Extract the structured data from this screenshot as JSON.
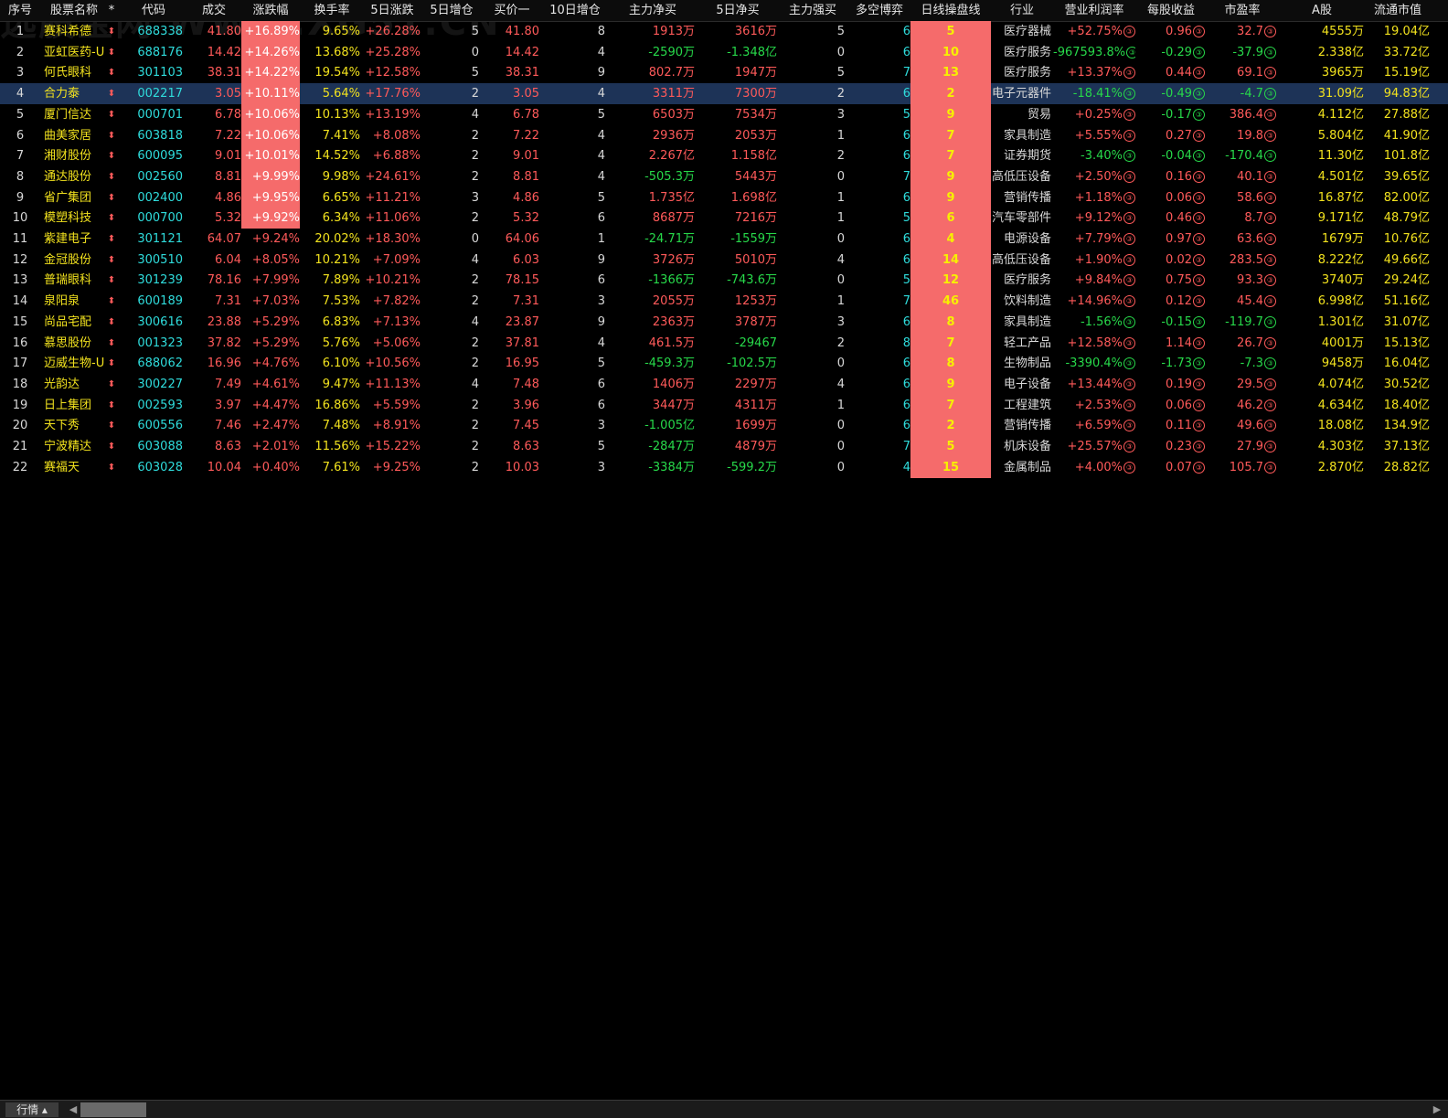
{
  "watermark": "选股宝网 WWW.XG51.CN",
  "header": [
    "序号",
    "股票名称",
    "*",
    "代码",
    "成交",
    "涨跌幅",
    "换手率",
    "5日涨跌",
    "5日增仓",
    "买价一",
    "10日增仓",
    "主力净买",
    "5日净买",
    "主力强买",
    "多空博弈",
    "日线操盘线",
    "行业",
    "营业利润率",
    "每股收益",
    "市盈率",
    "A股",
    "流通市值"
  ],
  "selected_row": 3,
  "rows": [
    [
      "1",
      "赛科希德",
      "⬍",
      "688338",
      "41.80",
      "+16.89%",
      "9.65%",
      "+26.28%",
      "5",
      "41.80",
      "8",
      "1913万",
      "3616万",
      "5",
      "6",
      "5",
      "医疗器械",
      "+52.75%",
      "0.96",
      "32.7",
      "4555万",
      "19.04亿"
    ],
    [
      "2",
      "亚虹医药-U",
      "⬍",
      "688176",
      "14.42",
      "+14.26%",
      "13.68%",
      "+25.28%",
      "0",
      "14.42",
      "4",
      "-2590万",
      "-1.348亿",
      "0",
      "6",
      "10",
      "医疗服务",
      "-967593.8%",
      "-0.29",
      "-37.9",
      "2.338亿",
      "33.72亿"
    ],
    [
      "3",
      "何氏眼科",
      "⬍",
      "301103",
      "38.31",
      "+14.22%",
      "19.54%",
      "+12.58%",
      "5",
      "38.31",
      "9",
      "802.7万",
      "1947万",
      "5",
      "7",
      "13",
      "医疗服务",
      "+13.37%",
      "0.44",
      "69.1",
      "3965万",
      "15.19亿"
    ],
    [
      "4",
      "合力泰",
      "⬍",
      "002217",
      "3.05",
      "+10.11%",
      "5.64%",
      "+17.76%",
      "2",
      "3.05",
      "4",
      "3311万",
      "7300万",
      "2",
      "6",
      "2",
      "电子元器件",
      "-18.41%",
      "-0.49",
      "-4.7",
      "31.09亿",
      "94.83亿"
    ],
    [
      "5",
      "厦门信达",
      "⬍",
      "000701",
      "6.78",
      "+10.06%",
      "10.13%",
      "+13.19%",
      "4",
      "6.78",
      "5",
      "6503万",
      "7534万",
      "3",
      "5",
      "9",
      "贸易",
      "+0.25%",
      "-0.17",
      "386.4",
      "4.112亿",
      "27.88亿"
    ],
    [
      "6",
      "曲美家居",
      "⬍",
      "603818",
      "7.22",
      "+10.06%",
      "7.41%",
      "+8.08%",
      "2",
      "7.22",
      "4",
      "2936万",
      "2053万",
      "1",
      "6",
      "7",
      "家具制造",
      "+5.55%",
      "0.27",
      "19.8",
      "5.804亿",
      "41.90亿"
    ],
    [
      "7",
      "湘财股份",
      "⬍",
      "600095",
      "9.01",
      "+10.01%",
      "14.52%",
      "+6.88%",
      "2",
      "9.01",
      "4",
      "2.267亿",
      "1.158亿",
      "2",
      "6",
      "7",
      "证券期货",
      "-3.40%",
      "-0.04",
      "-170.4",
      "11.30亿",
      "101.8亿"
    ],
    [
      "8",
      "通达股份",
      "⬍",
      "002560",
      "8.81",
      "+9.99%",
      "9.98%",
      "+24.61%",
      "2",
      "8.81",
      "4",
      "-505.3万",
      "5443万",
      "0",
      "7",
      "9",
      "高低压设备",
      "+2.50%",
      "0.16",
      "40.1",
      "4.501亿",
      "39.65亿"
    ],
    [
      "9",
      "省广集团",
      "⬍",
      "002400",
      "4.86",
      "+9.95%",
      "6.65%",
      "+11.21%",
      "3",
      "4.86",
      "5",
      "1.735亿",
      "1.698亿",
      "1",
      "6",
      "9",
      "营销传播",
      "+1.18%",
      "0.06",
      "58.6",
      "16.87亿",
      "82.00亿"
    ],
    [
      "10",
      "模塑科技",
      "⬍",
      "000700",
      "5.32",
      "+9.92%",
      "6.34%",
      "+11.06%",
      "2",
      "5.32",
      "6",
      "8687万",
      "7216万",
      "1",
      "5",
      "6",
      "汽车零部件",
      "+9.12%",
      "0.46",
      "8.7",
      "9.171亿",
      "48.79亿"
    ],
    [
      "11",
      "紫建电子",
      "⬍",
      "301121",
      "64.07",
      "+9.24%",
      "20.02%",
      "+18.30%",
      "0",
      "64.06",
      "1",
      "-24.71万",
      "-1559万",
      "0",
      "6",
      "4",
      "电源设备",
      "+7.79%",
      "0.97",
      "63.6",
      "1679万",
      "10.76亿"
    ],
    [
      "12",
      "金冠股份",
      "⬍",
      "300510",
      "6.04",
      "+8.05%",
      "10.21%",
      "+7.09%",
      "4",
      "6.03",
      "9",
      "3726万",
      "5010万",
      "4",
      "6",
      "14",
      "高低压设备",
      "+1.90%",
      "0.02",
      "283.5",
      "8.222亿",
      "49.66亿"
    ],
    [
      "13",
      "普瑞眼科",
      "⬍",
      "301239",
      "78.16",
      "+7.99%",
      "7.89%",
      "+10.21%",
      "2",
      "78.15",
      "6",
      "-1366万",
      "-743.6万",
      "0",
      "5",
      "12",
      "医疗服务",
      "+9.84%",
      "0.75",
      "93.3",
      "3740万",
      "29.24亿"
    ],
    [
      "14",
      "泉阳泉",
      "⬍",
      "600189",
      "7.31",
      "+7.03%",
      "7.53%",
      "+7.82%",
      "2",
      "7.31",
      "3",
      "2055万",
      "1253万",
      "1",
      "7",
      "46",
      "饮料制造",
      "+14.96%",
      "0.12",
      "45.4",
      "6.998亿",
      "51.16亿"
    ],
    [
      "15",
      "尚品宅配",
      "⬍",
      "300616",
      "23.88",
      "+5.29%",
      "6.83%",
      "+7.13%",
      "4",
      "23.87",
      "9",
      "2363万",
      "3787万",
      "3",
      "6",
      "8",
      "家具制造",
      "-1.56%",
      "-0.15",
      "-119.7",
      "1.301亿",
      "31.07亿"
    ],
    [
      "16",
      "慕思股份",
      "⬍",
      "001323",
      "37.82",
      "+5.29%",
      "5.76%",
      "+5.06%",
      "2",
      "37.81",
      "4",
      "461.5万",
      "-29467",
      "2",
      "8",
      "7",
      "轻工产品",
      "+12.58%",
      "1.14",
      "26.7",
      "4001万",
      "15.13亿"
    ],
    [
      "17",
      "迈威生物-U",
      "⬍",
      "688062",
      "16.96",
      "+4.76%",
      "6.10%",
      "+10.56%",
      "2",
      "16.95",
      "5",
      "-459.3万",
      "-102.5万",
      "0",
      "6",
      "8",
      "生物制品",
      "-3390.4%",
      "-1.73",
      "-7.3",
      "9458万",
      "16.04亿"
    ],
    [
      "18",
      "光韵达",
      "⬍",
      "300227",
      "7.49",
      "+4.61%",
      "9.47%",
      "+11.13%",
      "4",
      "7.48",
      "6",
      "1406万",
      "2297万",
      "4",
      "6",
      "9",
      "电子设备",
      "+13.44%",
      "0.19",
      "29.5",
      "4.074亿",
      "30.52亿"
    ],
    [
      "19",
      "日上集团",
      "⬍",
      "002593",
      "3.97",
      "+4.47%",
      "16.86%",
      "+5.59%",
      "2",
      "3.96",
      "6",
      "3447万",
      "4311万",
      "1",
      "6",
      "7",
      "工程建筑",
      "+2.53%",
      "0.06",
      "46.2",
      "4.634亿",
      "18.40亿"
    ],
    [
      "20",
      "天下秀",
      "⬍",
      "600556",
      "7.46",
      "+2.47%",
      "7.48%",
      "+8.91%",
      "2",
      "7.45",
      "3",
      "-1.005亿",
      "1699万",
      "0",
      "6",
      "2",
      "营销传播",
      "+6.59%",
      "0.11",
      "49.6",
      "18.08亿",
      "134.9亿"
    ],
    [
      "21",
      "宁波精达",
      "⬍",
      "603088",
      "8.63",
      "+2.01%",
      "11.56%",
      "+15.22%",
      "2",
      "8.63",
      "5",
      "-2847万",
      "4879万",
      "0",
      "7",
      "5",
      "机床设备",
      "+25.57%",
      "0.23",
      "27.9",
      "4.303亿",
      "37.13亿"
    ],
    [
      "22",
      "赛福天",
      "⬍",
      "603028",
      "10.04",
      "+0.40%",
      "7.61%",
      "+9.25%",
      "2",
      "10.03",
      "3",
      "-3384万",
      "-599.2万",
      "0",
      "4",
      "15",
      "金属制品",
      "+4.00%",
      "0.07",
      "105.7",
      "2.870亿",
      "28.82亿"
    ]
  ],
  "report_badge": "③",
  "statusbar": {
    "tab_label": "行情 ▴",
    "scroll_left": "◀",
    "scroll_right": "▶"
  },
  "colors": {
    "up": "#ff5a5a",
    "down": "#27d94a",
    "name": "#f2e21e",
    "code": "#2fdcdc",
    "highlight": "#f56b6b",
    "macd_text": "#f7f000",
    "selected": "#1d3357"
  }
}
